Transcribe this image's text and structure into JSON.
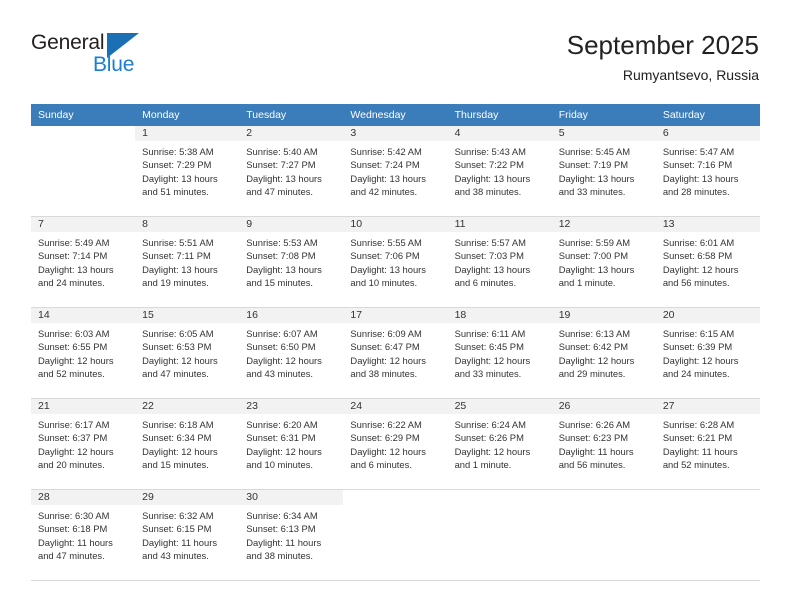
{
  "brand": {
    "line1": "General",
    "line2": "Blue",
    "mark": "triangle-logo"
  },
  "header": {
    "title": "September 2025",
    "location": "Rumyantsevo, Russia"
  },
  "weekday_headers": [
    "Sunday",
    "Monday",
    "Tuesday",
    "Wednesday",
    "Thursday",
    "Friday",
    "Saturday"
  ],
  "colors": {
    "header_band": "#3b7cba",
    "daynum_band": "#f2f2f2",
    "brand_blue": "#1a7fd4",
    "text": "#333333"
  },
  "weeks": [
    [
      {
        "day": "",
        "sunrise": "",
        "sunset": "",
        "daylight1": "",
        "daylight2": ""
      },
      {
        "day": "1",
        "sunrise": "Sunrise: 5:38 AM",
        "sunset": "Sunset: 7:29 PM",
        "daylight1": "Daylight: 13 hours",
        "daylight2": "and 51 minutes."
      },
      {
        "day": "2",
        "sunrise": "Sunrise: 5:40 AM",
        "sunset": "Sunset: 7:27 PM",
        "daylight1": "Daylight: 13 hours",
        "daylight2": "and 47 minutes."
      },
      {
        "day": "3",
        "sunrise": "Sunrise: 5:42 AM",
        "sunset": "Sunset: 7:24 PM",
        "daylight1": "Daylight: 13 hours",
        "daylight2": "and 42 minutes."
      },
      {
        "day": "4",
        "sunrise": "Sunrise: 5:43 AM",
        "sunset": "Sunset: 7:22 PM",
        "daylight1": "Daylight: 13 hours",
        "daylight2": "and 38 minutes."
      },
      {
        "day": "5",
        "sunrise": "Sunrise: 5:45 AM",
        "sunset": "Sunset: 7:19 PM",
        "daylight1": "Daylight: 13 hours",
        "daylight2": "and 33 minutes."
      },
      {
        "day": "6",
        "sunrise": "Sunrise: 5:47 AM",
        "sunset": "Sunset: 7:16 PM",
        "daylight1": "Daylight: 13 hours",
        "daylight2": "and 28 minutes."
      }
    ],
    [
      {
        "day": "7",
        "sunrise": "Sunrise: 5:49 AM",
        "sunset": "Sunset: 7:14 PM",
        "daylight1": "Daylight: 13 hours",
        "daylight2": "and 24 minutes."
      },
      {
        "day": "8",
        "sunrise": "Sunrise: 5:51 AM",
        "sunset": "Sunset: 7:11 PM",
        "daylight1": "Daylight: 13 hours",
        "daylight2": "and 19 minutes."
      },
      {
        "day": "9",
        "sunrise": "Sunrise: 5:53 AM",
        "sunset": "Sunset: 7:08 PM",
        "daylight1": "Daylight: 13 hours",
        "daylight2": "and 15 minutes."
      },
      {
        "day": "10",
        "sunrise": "Sunrise: 5:55 AM",
        "sunset": "Sunset: 7:06 PM",
        "daylight1": "Daylight: 13 hours",
        "daylight2": "and 10 minutes."
      },
      {
        "day": "11",
        "sunrise": "Sunrise: 5:57 AM",
        "sunset": "Sunset: 7:03 PM",
        "daylight1": "Daylight: 13 hours",
        "daylight2": "and 6 minutes."
      },
      {
        "day": "12",
        "sunrise": "Sunrise: 5:59 AM",
        "sunset": "Sunset: 7:00 PM",
        "daylight1": "Daylight: 13 hours",
        "daylight2": "and 1 minute."
      },
      {
        "day": "13",
        "sunrise": "Sunrise: 6:01 AM",
        "sunset": "Sunset: 6:58 PM",
        "daylight1": "Daylight: 12 hours",
        "daylight2": "and 56 minutes."
      }
    ],
    [
      {
        "day": "14",
        "sunrise": "Sunrise: 6:03 AM",
        "sunset": "Sunset: 6:55 PM",
        "daylight1": "Daylight: 12 hours",
        "daylight2": "and 52 minutes."
      },
      {
        "day": "15",
        "sunrise": "Sunrise: 6:05 AM",
        "sunset": "Sunset: 6:53 PM",
        "daylight1": "Daylight: 12 hours",
        "daylight2": "and 47 minutes."
      },
      {
        "day": "16",
        "sunrise": "Sunrise: 6:07 AM",
        "sunset": "Sunset: 6:50 PM",
        "daylight1": "Daylight: 12 hours",
        "daylight2": "and 43 minutes."
      },
      {
        "day": "17",
        "sunrise": "Sunrise: 6:09 AM",
        "sunset": "Sunset: 6:47 PM",
        "daylight1": "Daylight: 12 hours",
        "daylight2": "and 38 minutes."
      },
      {
        "day": "18",
        "sunrise": "Sunrise: 6:11 AM",
        "sunset": "Sunset: 6:45 PM",
        "daylight1": "Daylight: 12 hours",
        "daylight2": "and 33 minutes."
      },
      {
        "day": "19",
        "sunrise": "Sunrise: 6:13 AM",
        "sunset": "Sunset: 6:42 PM",
        "daylight1": "Daylight: 12 hours",
        "daylight2": "and 29 minutes."
      },
      {
        "day": "20",
        "sunrise": "Sunrise: 6:15 AM",
        "sunset": "Sunset: 6:39 PM",
        "daylight1": "Daylight: 12 hours",
        "daylight2": "and 24 minutes."
      }
    ],
    [
      {
        "day": "21",
        "sunrise": "Sunrise: 6:17 AM",
        "sunset": "Sunset: 6:37 PM",
        "daylight1": "Daylight: 12 hours",
        "daylight2": "and 20 minutes."
      },
      {
        "day": "22",
        "sunrise": "Sunrise: 6:18 AM",
        "sunset": "Sunset: 6:34 PM",
        "daylight1": "Daylight: 12 hours",
        "daylight2": "and 15 minutes."
      },
      {
        "day": "23",
        "sunrise": "Sunrise: 6:20 AM",
        "sunset": "Sunset: 6:31 PM",
        "daylight1": "Daylight: 12 hours",
        "daylight2": "and 10 minutes."
      },
      {
        "day": "24",
        "sunrise": "Sunrise: 6:22 AM",
        "sunset": "Sunset: 6:29 PM",
        "daylight1": "Daylight: 12 hours",
        "daylight2": "and 6 minutes."
      },
      {
        "day": "25",
        "sunrise": "Sunrise: 6:24 AM",
        "sunset": "Sunset: 6:26 PM",
        "daylight1": "Daylight: 12 hours",
        "daylight2": "and 1 minute."
      },
      {
        "day": "26",
        "sunrise": "Sunrise: 6:26 AM",
        "sunset": "Sunset: 6:23 PM",
        "daylight1": "Daylight: 11 hours",
        "daylight2": "and 56 minutes."
      },
      {
        "day": "27",
        "sunrise": "Sunrise: 6:28 AM",
        "sunset": "Sunset: 6:21 PM",
        "daylight1": "Daylight: 11 hours",
        "daylight2": "and 52 minutes."
      }
    ],
    [
      {
        "day": "28",
        "sunrise": "Sunrise: 6:30 AM",
        "sunset": "Sunset: 6:18 PM",
        "daylight1": "Daylight: 11 hours",
        "daylight2": "and 47 minutes."
      },
      {
        "day": "29",
        "sunrise": "Sunrise: 6:32 AM",
        "sunset": "Sunset: 6:15 PM",
        "daylight1": "Daylight: 11 hours",
        "daylight2": "and 43 minutes."
      },
      {
        "day": "30",
        "sunrise": "Sunrise: 6:34 AM",
        "sunset": "Sunset: 6:13 PM",
        "daylight1": "Daylight: 11 hours",
        "daylight2": "and 38 minutes."
      },
      {
        "day": "",
        "sunrise": "",
        "sunset": "",
        "daylight1": "",
        "daylight2": ""
      },
      {
        "day": "",
        "sunrise": "",
        "sunset": "",
        "daylight1": "",
        "daylight2": ""
      },
      {
        "day": "",
        "sunrise": "",
        "sunset": "",
        "daylight1": "",
        "daylight2": ""
      },
      {
        "day": "",
        "sunrise": "",
        "sunset": "",
        "daylight1": "",
        "daylight2": ""
      }
    ]
  ]
}
